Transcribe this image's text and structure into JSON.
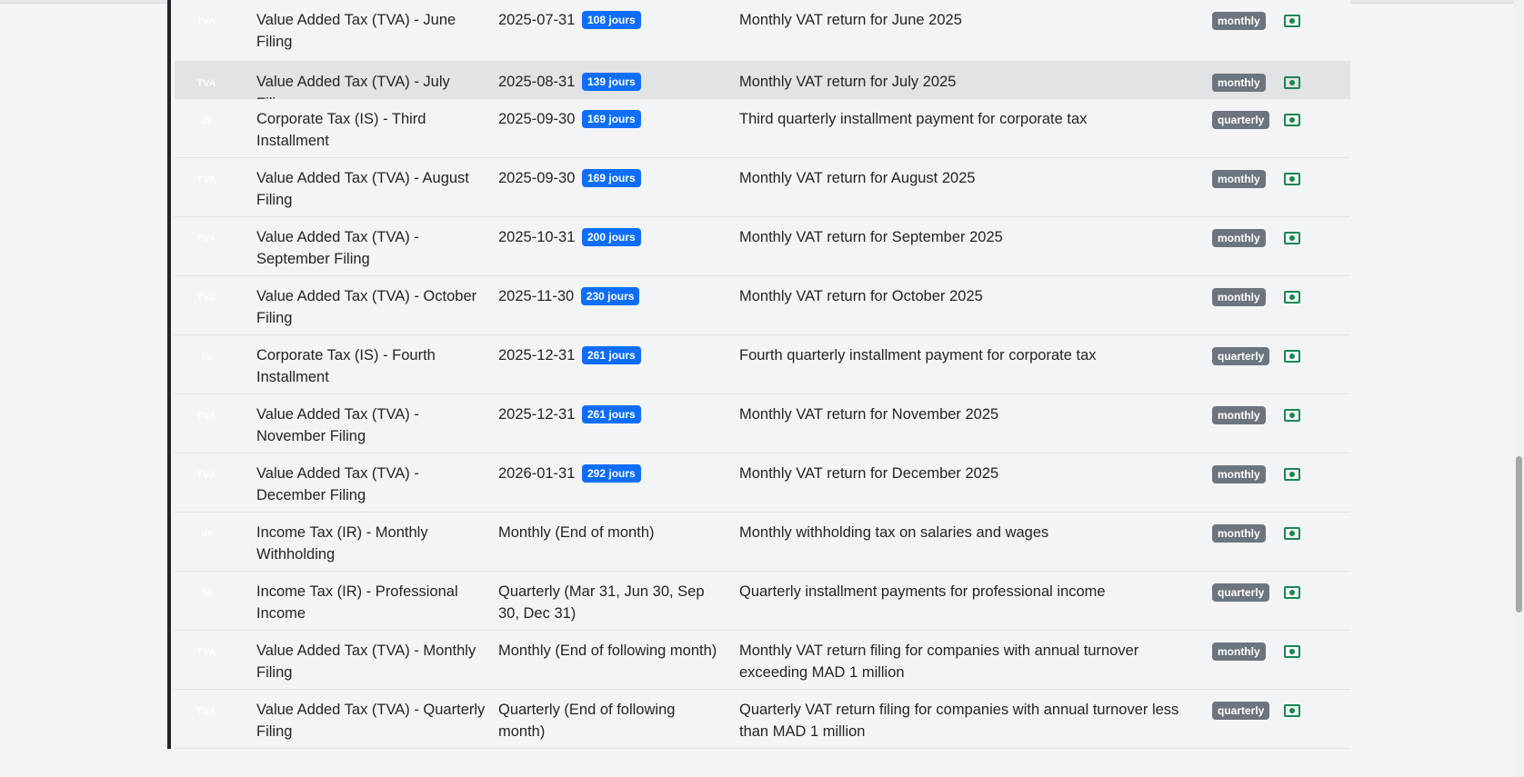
{
  "rows": [
    {
      "code": "TVA",
      "name": "Value Added Tax (TVA) - June Filing",
      "date": "2025-07-31",
      "days": "108 jours",
      "desc": "Monthly VAT return for June 2025",
      "freq": "monthly"
    },
    {
      "code": "TVA",
      "name": "Value Added Tax (TVA) - July Filing",
      "date": "2025-08-31",
      "days": "139 jours",
      "desc": "Monthly VAT return for July 2025",
      "freq": "monthly",
      "highlighted": true
    },
    {
      "code": "IS",
      "name": "Corporate Tax (IS) - Third Installment",
      "date": "2025-09-30",
      "days": "169 jours",
      "desc": "Third quarterly installment payment for corporate tax",
      "freq": "quarterly"
    },
    {
      "code": "TVA",
      "name": "Value Added Tax (TVA) - August Filing",
      "date": "2025-09-30",
      "days": "169 jours",
      "desc": "Monthly VAT return for August 2025",
      "freq": "monthly"
    },
    {
      "code": "TVA",
      "name": "Value Added Tax (TVA) - September Filing",
      "date": "2025-10-31",
      "days": "200 jours",
      "desc": "Monthly VAT return for September 2025",
      "freq": "monthly"
    },
    {
      "code": "TVA",
      "name": "Value Added Tax (TVA) - October Filing",
      "date": "2025-11-30",
      "days": "230 jours",
      "desc": "Monthly VAT return for October 2025",
      "freq": "monthly"
    },
    {
      "code": "IS",
      "name": "Corporate Tax (IS) - Fourth Installment",
      "date": "2025-12-31",
      "days": "261 jours",
      "desc": "Fourth quarterly installment payment for corporate tax",
      "freq": "quarterly"
    },
    {
      "code": "TVA",
      "name": "Value Added Tax (TVA) - November Filing",
      "date": "2025-12-31",
      "days": "261 jours",
      "desc": "Monthly VAT return for November 2025",
      "freq": "monthly"
    },
    {
      "code": "TVA",
      "name": "Value Added Tax (TVA) - December Filing",
      "date": "2026-01-31",
      "days": "292 jours",
      "desc": "Monthly VAT return for December 2025",
      "freq": "monthly"
    },
    {
      "code": "IR",
      "name": "Income Tax (IR) - Monthly Withholding",
      "date": "Monthly (End of month)",
      "days": "",
      "desc": "Monthly withholding tax on salaries and wages",
      "freq": "monthly"
    },
    {
      "code": "IR",
      "name": "Income Tax (IR) - Professional Income",
      "date": "Quarterly (Mar 31, Jun 30, Sep 30, Dec 31)",
      "days": "",
      "desc": "Quarterly installment payments for professional income",
      "freq": "quarterly"
    },
    {
      "code": "TVA",
      "name": "Value Added Tax (TVA) - Monthly Filing",
      "date": "Monthly (End of following month)",
      "days": "",
      "desc": "Monthly VAT return filing for companies with annual turnover exceeding MAD 1 million",
      "freq": "monthly"
    },
    {
      "code": "TVA",
      "name": "Value Added Tax (TVA) - Quarterly Filing",
      "date": "Quarterly (End of following month)",
      "days": "",
      "desc": "Quarterly VAT return filing for companies with annual turnover less than MAD 1 million",
      "freq": "quarterly"
    }
  ],
  "colors": {
    "days_badge": "#0d6efd",
    "freq_badge": "#6c757d",
    "action_icon": "#198754",
    "highlight_row": "#e2e3e5"
  },
  "icons": {
    "row_action": "view-icon"
  }
}
